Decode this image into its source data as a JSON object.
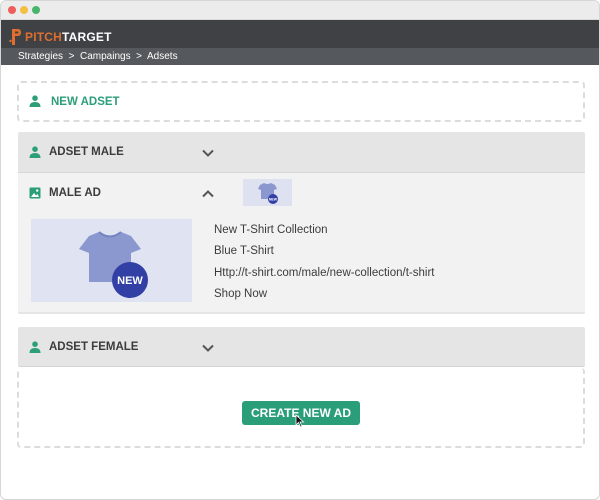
{
  "app": {
    "logo_part1": "PITCH",
    "logo_part2": "TARGET",
    "brand_color": "#e06f2f",
    "accent_color": "#2a9e79"
  },
  "breadcrumb": {
    "items": [
      "Strategies",
      "Campaings",
      "Adsets"
    ],
    "separator": ">"
  },
  "new_adset": {
    "label": "NEW ADSET",
    "icon": "person-icon"
  },
  "adsets": [
    {
      "title": "ADSET MALE",
      "icon": "person-icon",
      "expanded": true,
      "ads": [
        {
          "title": "MALE AD",
          "icon": "image-icon",
          "expanded": true,
          "badge": "NEW",
          "headline": "New T-Shirt Collection",
          "description": "Blue T-Shirt",
          "url": "Http://t-shirt.com/male/new-collection/t-shirt",
          "cta": "Shop Now"
        }
      ]
    },
    {
      "title": "ADSET FEMALE",
      "icon": "person-icon",
      "expanded": false
    }
  ],
  "create_button": {
    "label": "CREATE NEW AD"
  }
}
